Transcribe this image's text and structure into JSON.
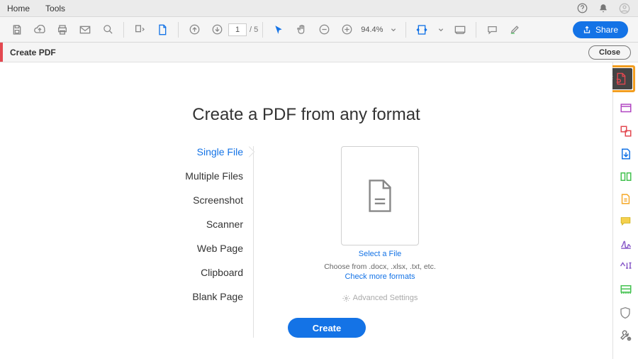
{
  "menu": {
    "home": "Home",
    "tools": "Tools"
  },
  "toolbar": {
    "page_current": "1",
    "page_total": "/  5",
    "zoom": "94.4%",
    "share": "Share"
  },
  "subbar": {
    "title": "Create PDF",
    "close": "Close"
  },
  "tooltip": {
    "label": "Create PDF"
  },
  "main": {
    "heading": "Create a PDF from any format",
    "options": {
      "single": "Single File",
      "multiple": "Multiple Files",
      "screenshot": "Screenshot",
      "scanner": "Scanner",
      "webpage": "Web Page",
      "clipboard": "Clipboard",
      "blank": "Blank Page"
    },
    "select_file": "Select a File",
    "choose_hint": "Choose from .docx, .xlsx, .txt, etc.",
    "check_formats": "Check more formats",
    "advanced": "Advanced Settings",
    "create": "Create"
  }
}
